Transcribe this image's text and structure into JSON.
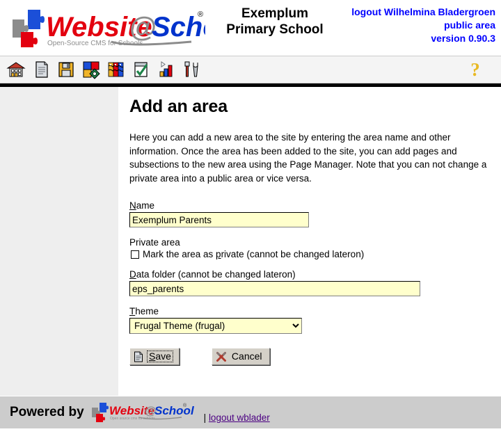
{
  "header": {
    "logo_alt": "Website@School",
    "logo_word1": "Website",
    "logo_at": "@",
    "logo_word2": "School",
    "logo_tagline": "Open-Source CMS for Schools",
    "logo_registered": "®",
    "school_name_line1": "Exemplum",
    "school_name_line2": "Primary School",
    "logout_line": "logout Wilhelmina Bladergroen",
    "area_line": "public area",
    "version_line": "version 0.90.3"
  },
  "toolbar": {
    "items": [
      {
        "name": "home-icon",
        "title": "Home"
      },
      {
        "name": "file-icon",
        "title": "Pages"
      },
      {
        "name": "save-disk-icon",
        "title": "Save"
      },
      {
        "name": "puzzle-modules-icon",
        "title": "Modules"
      },
      {
        "name": "users-icon",
        "title": "Users"
      },
      {
        "name": "checklist-icon",
        "title": "Tasks"
      },
      {
        "name": "statistics-icon",
        "title": "Statistics"
      },
      {
        "name": "tools-icon",
        "title": "Tools"
      }
    ],
    "help_label": "?",
    "help_title": "Help"
  },
  "main": {
    "title": "Add an area",
    "intro": "Here you can add a new area to the site by entering the area name and other information. Once the area has been added to the site, you can add pages and subsections to the new area using the Page Manager. Note that you can not change a private area into a public area or vice versa."
  },
  "form": {
    "name": {
      "label_accesskey": "N",
      "label_rest": "ame",
      "value": "Exemplum Parents",
      "placeholder": ""
    },
    "private": {
      "group_label": "Private area",
      "checkbox_checked": false,
      "text_before": "Mark the area as ",
      "text_accesskey": "p",
      "text_after": "rivate (cannot be changed lateron)"
    },
    "data_folder": {
      "label_accesskey": "D",
      "label_rest": "ata folder (cannot be changed lateron)",
      "value": "eps_parents",
      "placeholder": ""
    },
    "theme": {
      "label_accesskey": "T",
      "label_rest": "heme",
      "selected": "Frugal Theme (frugal)",
      "options": [
        "Frugal Theme (frugal)"
      ]
    },
    "save_button": {
      "accesskey": "S",
      "rest": "ave",
      "icon": "page-icon"
    },
    "cancel_button": {
      "label": "Cancel",
      "icon": "cross-swords-icon"
    }
  },
  "footer": {
    "powered_by": "Powered by",
    "logo_word1": "Website",
    "logo_at": "@",
    "logo_word2": "School",
    "logo_tagline": "Open source cms for schools",
    "logo_registered": "®",
    "separator": "|",
    "logout_link": "logout wblader"
  },
  "colors": {
    "accent_blue": "#0000ff",
    "logo_red": "#e3000f",
    "logo_blue": "#0033cc",
    "field_yellow": "#ffffcc",
    "help_yellow": "#e8b923",
    "sidebar_gray": "#eeeeee",
    "footer_gray": "#cccccc",
    "link_purple": "#4b0082"
  }
}
